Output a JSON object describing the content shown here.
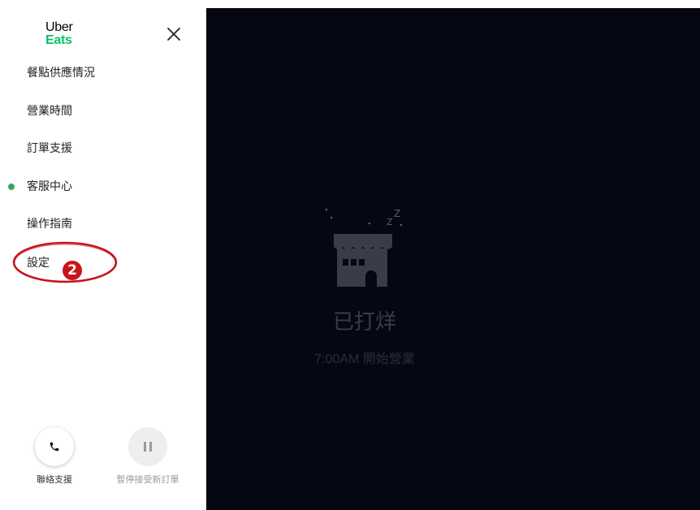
{
  "colors": {
    "brand_green": "#06c167",
    "active_dot": "#3aa657",
    "main_bg": "#050712",
    "muted_text": "#3a3c48",
    "muted_sub": "#2a2c38",
    "annotation_red": "#c8141c"
  },
  "logo": {
    "line1": "Uber",
    "line2": "Eats"
  },
  "header": {
    "close_icon": "close-icon"
  },
  "menu": {
    "items": [
      {
        "label": "餐點供應情況",
        "active": false
      },
      {
        "label": "營業時間",
        "active": false
      },
      {
        "label": "訂單支援",
        "active": false
      },
      {
        "label": "客服中心",
        "active": true
      },
      {
        "label": "操作指南",
        "active": false
      },
      {
        "label": "設定",
        "active": false
      }
    ]
  },
  "annotation": {
    "number": "2"
  },
  "bottom_actions": {
    "contact": {
      "label": "聯絡支援",
      "icon": "phone-icon"
    },
    "pause": {
      "label": "暫停接受新訂單",
      "icon": "pause-icon"
    }
  },
  "main": {
    "status_title": "已打烊",
    "status_subtitle": "7:00AM 開始營業",
    "illustration": "closed-store-icon"
  }
}
